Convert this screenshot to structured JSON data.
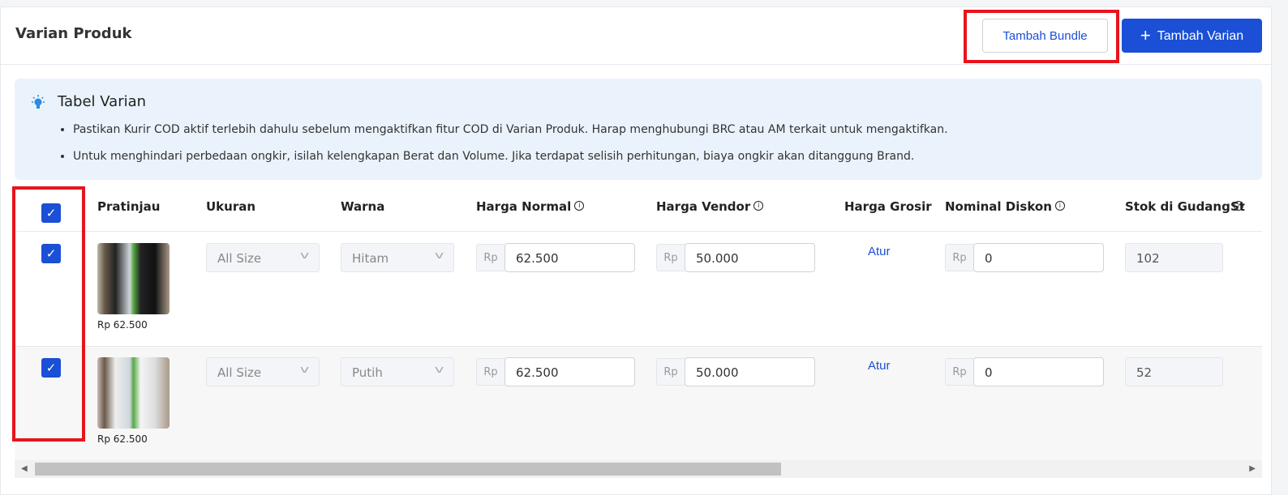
{
  "header": {
    "title": "Varian Produk",
    "bundle_button": "Tambah Bundle",
    "add_variant_button": "Tambah Varian",
    "add_icon": "+"
  },
  "info": {
    "icon": "lightbulb-icon",
    "title": "Tabel Varian",
    "notes": [
      "Pastikan Kurir COD aktif terlebih dahulu sebelum mengaktifkan fitur COD di Varian Produk. Harap menghubungi BRC atau AM terkait untuk mengaktifkan.",
      "Untuk menghindari perbedaan ongkir, isilah kelengkapan Berat dan Volume. Jika terdapat selisih perhitungan, biaya ongkir akan ditanggung Brand."
    ]
  },
  "table": {
    "select_all_checked": true,
    "columns": [
      "Pratinjau",
      "Ukuran",
      "Warna",
      "Harga Normal",
      "Harga Vendor",
      "Harga Grosir",
      "Nominal Diskon",
      "Stok di Gudang",
      "St"
    ],
    "currency_prefix": "Rp",
    "rows": [
      {
        "checked": true,
        "preview_price": "Rp 62.500",
        "size": "All Size",
        "color": "Hitam",
        "normal_price": "62.500",
        "vendor_price": "50.000",
        "wholesale": "Atur",
        "discount": "0",
        "stock": "102"
      },
      {
        "checked": true,
        "preview_price": "Rp 62.500",
        "size": "All Size",
        "color": "Putih",
        "normal_price": "62.500",
        "vendor_price": "50.000",
        "wholesale": "Atur",
        "discount": "0",
        "stock": "52"
      }
    ]
  },
  "colors": {
    "accent": "#1a4fd6",
    "highlight": "#e8141c",
    "info_bg": "#eaf3fc"
  }
}
